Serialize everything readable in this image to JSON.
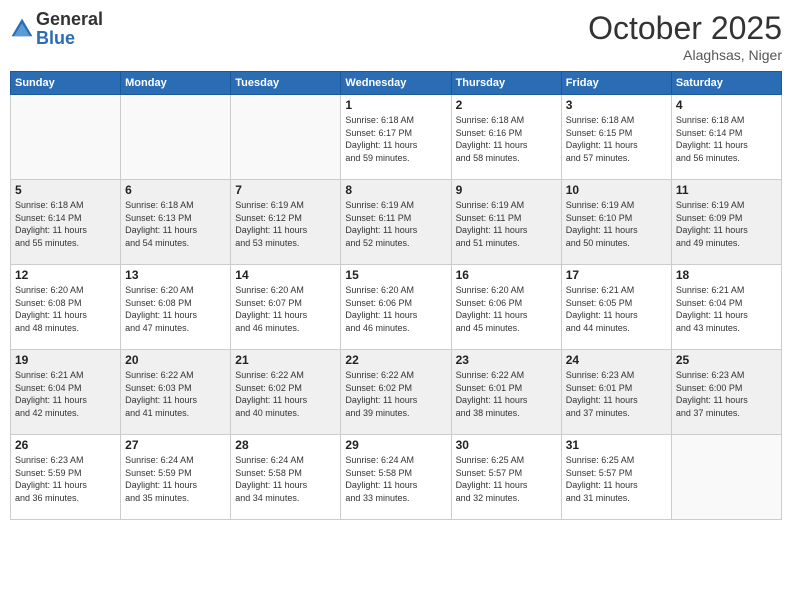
{
  "header": {
    "logo_general": "General",
    "logo_blue": "Blue",
    "month": "October 2025",
    "location": "Alaghsas, Niger"
  },
  "days_of_week": [
    "Sunday",
    "Monday",
    "Tuesday",
    "Wednesday",
    "Thursday",
    "Friday",
    "Saturday"
  ],
  "weeks": [
    [
      {
        "day": "",
        "info": ""
      },
      {
        "day": "",
        "info": ""
      },
      {
        "day": "",
        "info": ""
      },
      {
        "day": "1",
        "info": "Sunrise: 6:18 AM\nSunset: 6:17 PM\nDaylight: 11 hours\nand 59 minutes."
      },
      {
        "day": "2",
        "info": "Sunrise: 6:18 AM\nSunset: 6:16 PM\nDaylight: 11 hours\nand 58 minutes."
      },
      {
        "day": "3",
        "info": "Sunrise: 6:18 AM\nSunset: 6:15 PM\nDaylight: 11 hours\nand 57 minutes."
      },
      {
        "day": "4",
        "info": "Sunrise: 6:18 AM\nSunset: 6:14 PM\nDaylight: 11 hours\nand 56 minutes."
      }
    ],
    [
      {
        "day": "5",
        "info": "Sunrise: 6:18 AM\nSunset: 6:14 PM\nDaylight: 11 hours\nand 55 minutes."
      },
      {
        "day": "6",
        "info": "Sunrise: 6:18 AM\nSunset: 6:13 PM\nDaylight: 11 hours\nand 54 minutes."
      },
      {
        "day": "7",
        "info": "Sunrise: 6:19 AM\nSunset: 6:12 PM\nDaylight: 11 hours\nand 53 minutes."
      },
      {
        "day": "8",
        "info": "Sunrise: 6:19 AM\nSunset: 6:11 PM\nDaylight: 11 hours\nand 52 minutes."
      },
      {
        "day": "9",
        "info": "Sunrise: 6:19 AM\nSunset: 6:11 PM\nDaylight: 11 hours\nand 51 minutes."
      },
      {
        "day": "10",
        "info": "Sunrise: 6:19 AM\nSunset: 6:10 PM\nDaylight: 11 hours\nand 50 minutes."
      },
      {
        "day": "11",
        "info": "Sunrise: 6:19 AM\nSunset: 6:09 PM\nDaylight: 11 hours\nand 49 minutes."
      }
    ],
    [
      {
        "day": "12",
        "info": "Sunrise: 6:20 AM\nSunset: 6:08 PM\nDaylight: 11 hours\nand 48 minutes."
      },
      {
        "day": "13",
        "info": "Sunrise: 6:20 AM\nSunset: 6:08 PM\nDaylight: 11 hours\nand 47 minutes."
      },
      {
        "day": "14",
        "info": "Sunrise: 6:20 AM\nSunset: 6:07 PM\nDaylight: 11 hours\nand 46 minutes."
      },
      {
        "day": "15",
        "info": "Sunrise: 6:20 AM\nSunset: 6:06 PM\nDaylight: 11 hours\nand 46 minutes."
      },
      {
        "day": "16",
        "info": "Sunrise: 6:20 AM\nSunset: 6:06 PM\nDaylight: 11 hours\nand 45 minutes."
      },
      {
        "day": "17",
        "info": "Sunrise: 6:21 AM\nSunset: 6:05 PM\nDaylight: 11 hours\nand 44 minutes."
      },
      {
        "day": "18",
        "info": "Sunrise: 6:21 AM\nSunset: 6:04 PM\nDaylight: 11 hours\nand 43 minutes."
      }
    ],
    [
      {
        "day": "19",
        "info": "Sunrise: 6:21 AM\nSunset: 6:04 PM\nDaylight: 11 hours\nand 42 minutes."
      },
      {
        "day": "20",
        "info": "Sunrise: 6:22 AM\nSunset: 6:03 PM\nDaylight: 11 hours\nand 41 minutes."
      },
      {
        "day": "21",
        "info": "Sunrise: 6:22 AM\nSunset: 6:02 PM\nDaylight: 11 hours\nand 40 minutes."
      },
      {
        "day": "22",
        "info": "Sunrise: 6:22 AM\nSunset: 6:02 PM\nDaylight: 11 hours\nand 39 minutes."
      },
      {
        "day": "23",
        "info": "Sunrise: 6:22 AM\nSunset: 6:01 PM\nDaylight: 11 hours\nand 38 minutes."
      },
      {
        "day": "24",
        "info": "Sunrise: 6:23 AM\nSunset: 6:01 PM\nDaylight: 11 hours\nand 37 minutes."
      },
      {
        "day": "25",
        "info": "Sunrise: 6:23 AM\nSunset: 6:00 PM\nDaylight: 11 hours\nand 37 minutes."
      }
    ],
    [
      {
        "day": "26",
        "info": "Sunrise: 6:23 AM\nSunset: 5:59 PM\nDaylight: 11 hours\nand 36 minutes."
      },
      {
        "day": "27",
        "info": "Sunrise: 6:24 AM\nSunset: 5:59 PM\nDaylight: 11 hours\nand 35 minutes."
      },
      {
        "day": "28",
        "info": "Sunrise: 6:24 AM\nSunset: 5:58 PM\nDaylight: 11 hours\nand 34 minutes."
      },
      {
        "day": "29",
        "info": "Sunrise: 6:24 AM\nSunset: 5:58 PM\nDaylight: 11 hours\nand 33 minutes."
      },
      {
        "day": "30",
        "info": "Sunrise: 6:25 AM\nSunset: 5:57 PM\nDaylight: 11 hours\nand 32 minutes."
      },
      {
        "day": "31",
        "info": "Sunrise: 6:25 AM\nSunset: 5:57 PM\nDaylight: 11 hours\nand 31 minutes."
      },
      {
        "day": "",
        "info": ""
      }
    ]
  ]
}
